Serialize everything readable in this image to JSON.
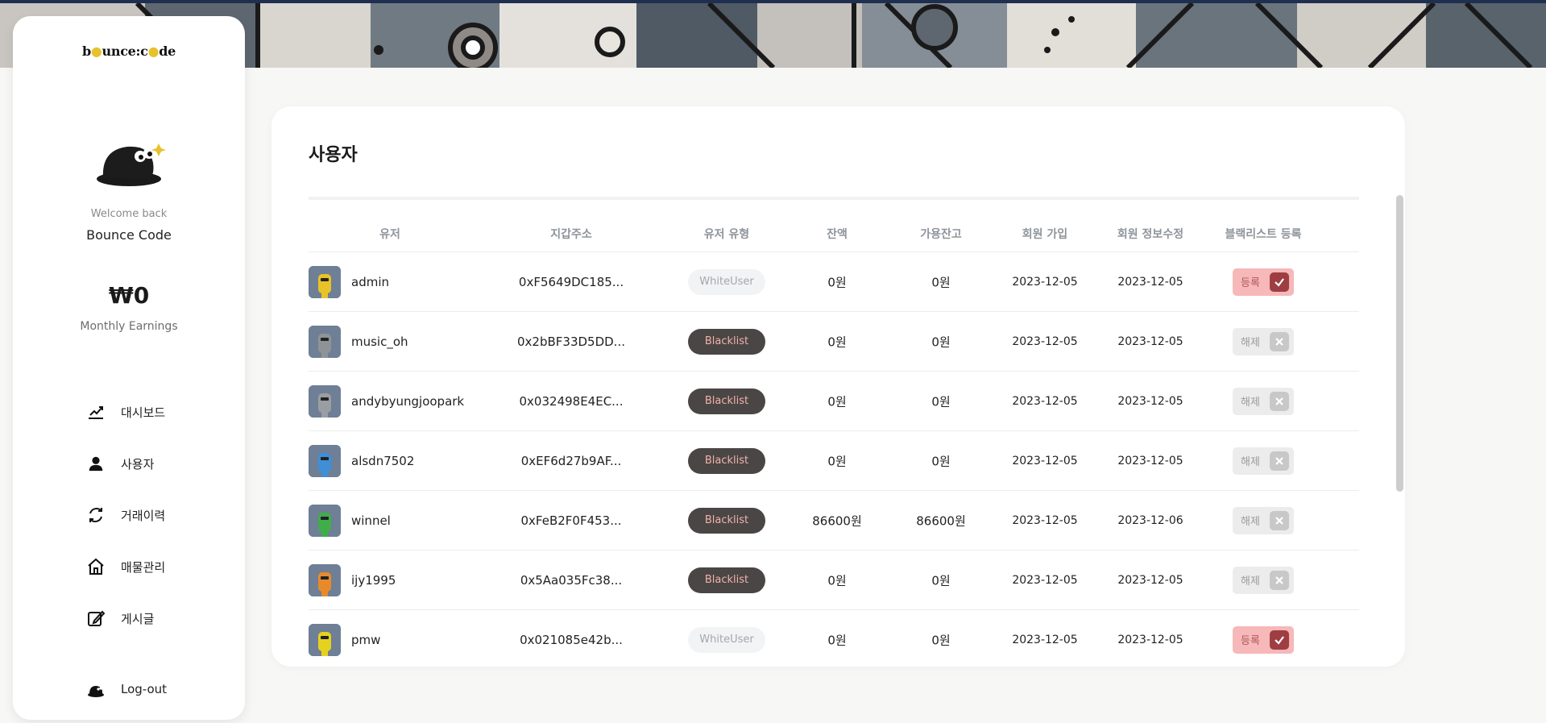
{
  "sidebar": {
    "logo": {
      "pre": "b",
      "mid": "unce:c",
      "post": "de"
    },
    "welcome": "Welcome back",
    "username": "Bounce Code",
    "earnings": "₩0",
    "earnings_label": "Monthly Earnings",
    "nav": [
      {
        "label": "대시보드",
        "icon": "chart-icon"
      },
      {
        "label": "사용자",
        "icon": "user-icon"
      },
      {
        "label": "거래이력",
        "icon": "exchange-icon"
      },
      {
        "label": "매물관리",
        "icon": "house-icon"
      },
      {
        "label": "게시글",
        "icon": "edit-icon"
      }
    ],
    "logout": "Log-out"
  },
  "main": {
    "title": "사용자",
    "columns": [
      "유저",
      "지갑주소",
      "유저 유형",
      "잔액",
      "가용잔고",
      "회원 가입",
      "회원 정보수정",
      "블랙리스트 등록"
    ],
    "rows": [
      {
        "user": "admin",
        "wallet": "0xF5649DC185...",
        "type": "WhiteUser",
        "balance": "0원",
        "available": "0원",
        "joined": "2023-12-05",
        "updated": "2023-12-05",
        "action": "등록",
        "blacklisted": false,
        "avatar_color": "#e8c328"
      },
      {
        "user": "music_oh",
        "wallet": "0x2bBF33D5DD...",
        "type": "Blacklist",
        "balance": "0원",
        "available": "0원",
        "joined": "2023-12-05",
        "updated": "2023-12-05",
        "action": "해제",
        "blacklisted": true,
        "avatar_color": "#8f9398"
      },
      {
        "user": "andybyungjoopark",
        "wallet": "0x032498E4EC...",
        "type": "Blacklist",
        "balance": "0원",
        "available": "0원",
        "joined": "2023-12-05",
        "updated": "2023-12-05",
        "action": "해제",
        "blacklisted": true,
        "avatar_color": "#9a9ea3"
      },
      {
        "user": "alsdn7502",
        "wallet": "0xEF6d27b9AF...",
        "type": "Blacklist",
        "balance": "0원",
        "available": "0원",
        "joined": "2023-12-05",
        "updated": "2023-12-05",
        "action": "해제",
        "blacklisted": true,
        "avatar_color": "#3f8fd6"
      },
      {
        "user": "winnel",
        "wallet": "0xFeB2F0F453...",
        "type": "Blacklist",
        "balance": "86600원",
        "available": "86600원",
        "joined": "2023-12-05",
        "updated": "2023-12-06",
        "action": "해제",
        "blacklisted": true,
        "avatar_color": "#3fae4a"
      },
      {
        "user": "ijy1995",
        "wallet": "0x5Aa035Fc38...",
        "type": "Blacklist",
        "balance": "0원",
        "available": "0원",
        "joined": "2023-12-05",
        "updated": "2023-12-05",
        "action": "해제",
        "blacklisted": true,
        "avatar_color": "#e88a2c"
      },
      {
        "user": "pmw",
        "wallet": "0x021085e42b...",
        "type": "WhiteUser",
        "balance": "0원",
        "available": "0원",
        "joined": "2023-12-05",
        "updated": "2023-12-05",
        "action": "등록",
        "blacklisted": false,
        "avatar_color": "#e6d21e"
      }
    ]
  },
  "colors": {
    "accent_on": "#f6b8b8",
    "accent_on_box": "#9e3e43",
    "blacklist_badge": "#4a4645",
    "topline": "#1f2f4f"
  }
}
